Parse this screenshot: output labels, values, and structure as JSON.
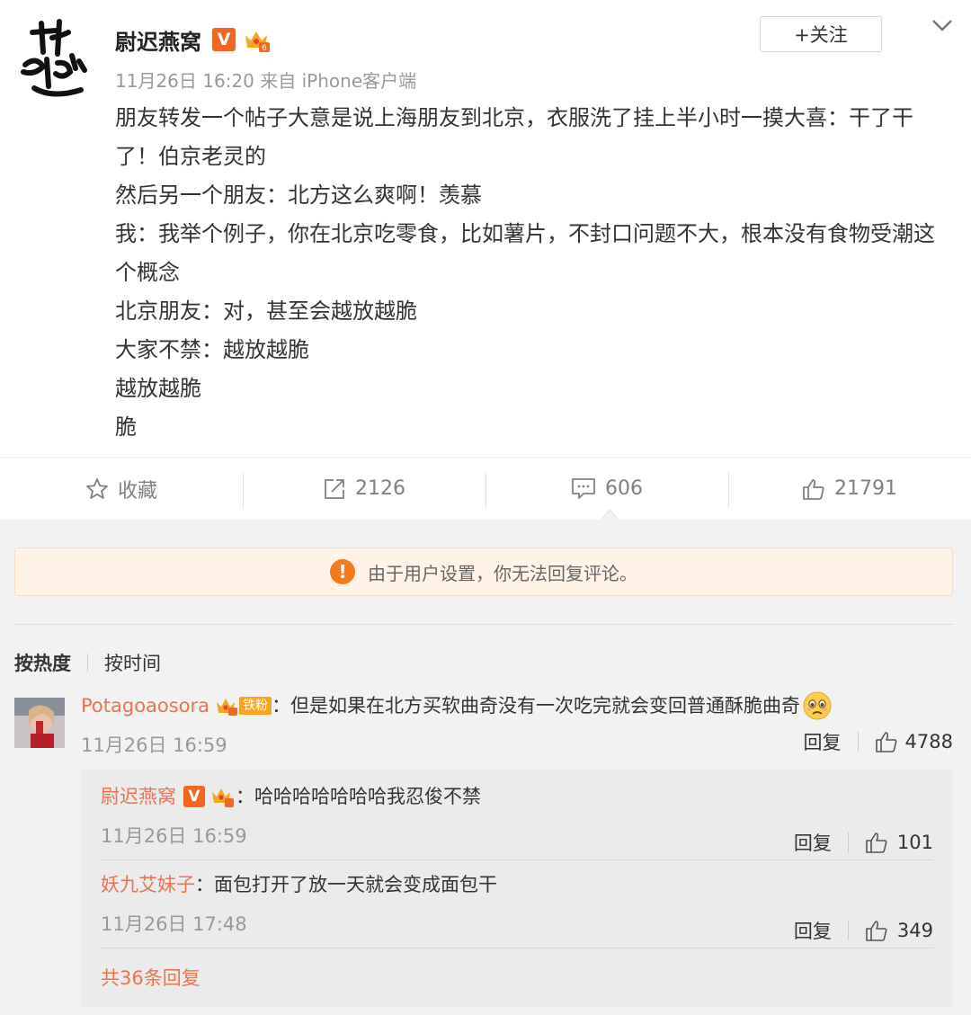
{
  "post": {
    "author": "尉迟燕窝",
    "verified_badge": "V",
    "timestamp": "11月26日 16:20",
    "source": "来自 iPhone客户端",
    "follow_label": "+关注",
    "body": [
      "朋友转发一个帖子大意是说上海朋友到北京，衣服洗了挂上半小时一摸大喜：干了干了！伯京老灵的",
      "然后另一个朋友：北方这么爽啊！羡慕",
      "我：我举个例子，你在北京吃零食，比如薯片，不封口问题不大，根本没有食物受潮这个概念",
      "北京朋友：对，甚至会越放越脆",
      "大家不禁：越放越脆",
      "越放越脆",
      "脆"
    ],
    "actions": {
      "favorite": "收藏",
      "repost_count": "2126",
      "comment_count": "606",
      "like_count": "21791"
    }
  },
  "notice": "由于用户设置，你无法回复评论。",
  "sort": {
    "hot": "按热度",
    "time": "按时间"
  },
  "comment": {
    "user": "Potagoaosora",
    "fan_label": "铁粉",
    "text": "：但是如果在北方买软曲奇没有一次吃完就会变回普通酥脆曲奇",
    "time": "11月26日 16:59",
    "reply_label": "回复",
    "likes": "4788"
  },
  "replies": [
    {
      "user": "尉迟燕窝",
      "badge": "V",
      "text": "：哈哈哈哈哈哈哈我忍俊不禁",
      "time": "11月26日 16:59",
      "reply_label": "回复",
      "likes": "101"
    },
    {
      "user": "妖九艾妹子",
      "text": "：面包打开了放一天就会变成面包干",
      "time": "11月26日 17:48",
      "reply_label": "回复",
      "likes": "349"
    }
  ],
  "more_replies": "共36条回复",
  "colors": {
    "accent_orange": "#ff8200",
    "username": "#eb7350",
    "verified": "#f26522",
    "notice_bg": "#fff3e8"
  }
}
